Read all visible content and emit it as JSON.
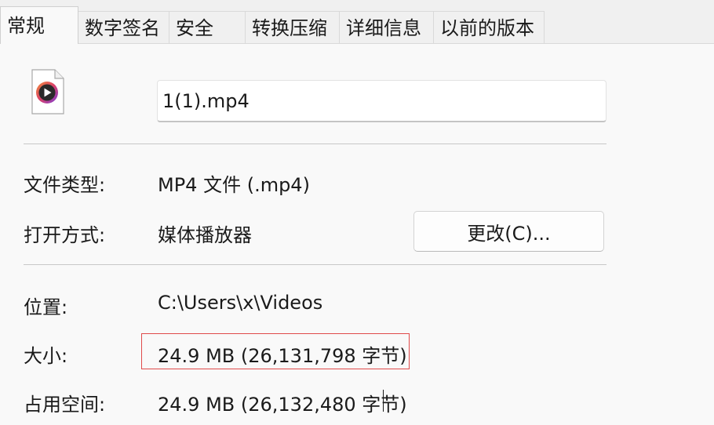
{
  "tabs": [
    {
      "label": "常规"
    },
    {
      "label": "数字签名"
    },
    {
      "label": "安全"
    },
    {
      "label": "转换压缩"
    },
    {
      "label": "详细信息"
    },
    {
      "label": "以前的版本"
    }
  ],
  "file": {
    "icon": "video-file-icon",
    "name": "1(1).mp4"
  },
  "properties": {
    "type_label": "文件类型:",
    "type_value": "MP4 文件 (.mp4)",
    "opens_with_label": "打开方式:",
    "opens_with_value": "媒体播放器",
    "change_button": "更改(C)...",
    "location_label": "位置:",
    "location_value": "C:\\Users\\x\\Videos",
    "size_label": "大小:",
    "size_value": "24.9 MB (26,131,798 字节)",
    "size_on_disk_label": "占用空间:",
    "size_on_disk_value": "24.9 MB (26,132,480 字节)"
  },
  "colors": {
    "highlight": "#e04a4a",
    "icon_accent": "#7a3fd8"
  }
}
